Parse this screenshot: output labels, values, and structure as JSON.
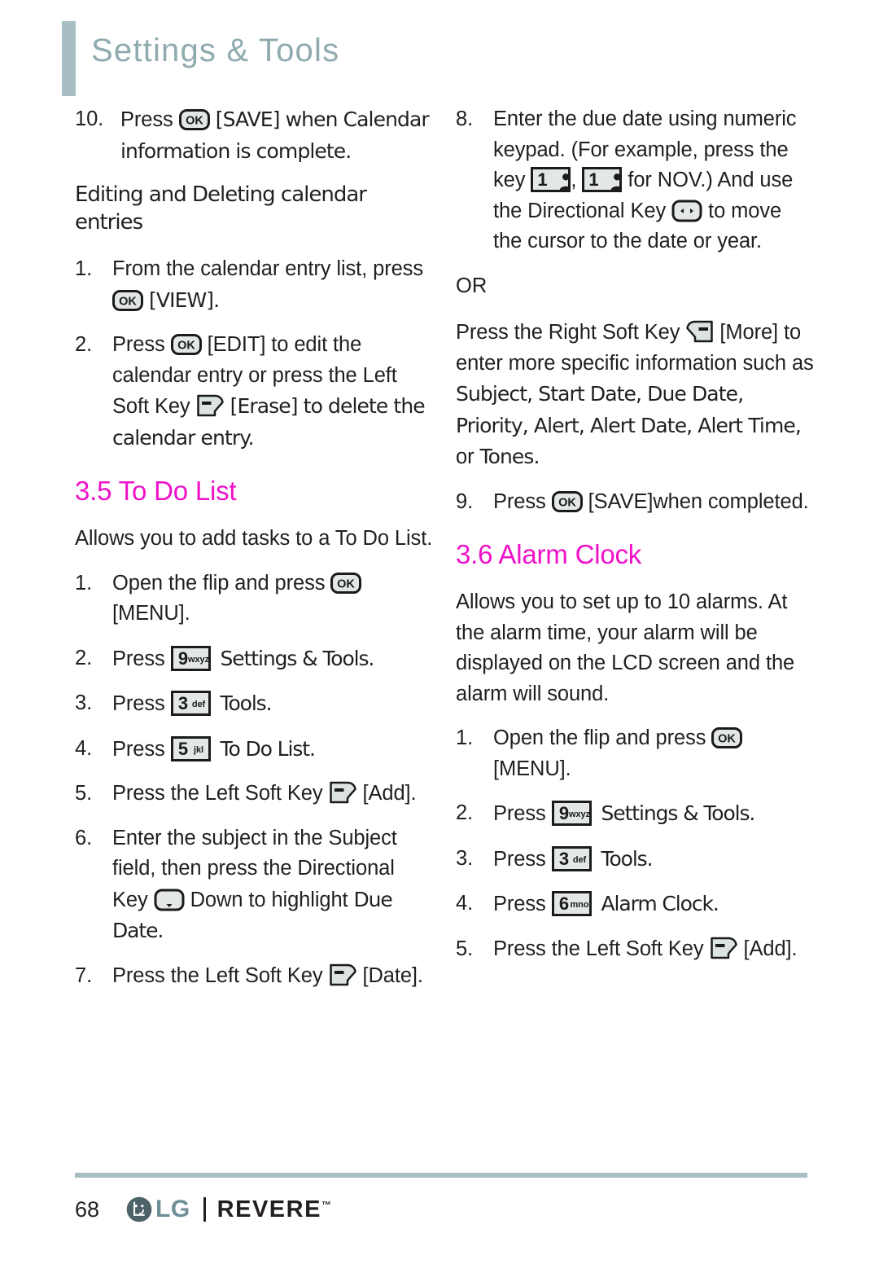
{
  "header": {
    "title": "Settings & Tools",
    "accent_color": "#a7bfc4"
  },
  "section_color": "#f011c9",
  "icons": {
    "ok_label": "OK",
    "key_9": {
      "digit": "9",
      "letters": "wxyz"
    },
    "key_3": {
      "digit": "3",
      "letters": "def"
    },
    "key_5": {
      "digit": "5",
      "letters": "jkl"
    },
    "key_6": {
      "digit": "6",
      "letters": "mno"
    },
    "key_1": {
      "digit": "1",
      "letters": ""
    }
  },
  "left_column": {
    "step10": {
      "num": "10.",
      "t1": "Press ",
      "t2": " [SAVE] when Calendar information is complete."
    },
    "subheading": "Editing and Deleting calendar entries",
    "step1": {
      "num": "1.",
      "t1": "From the calendar entry list, press ",
      "t2": " [VIEW]."
    },
    "step2": {
      "num": "2.",
      "t1": "Press ",
      "t2": " [EDIT] to edit the calendar entry or press the Left Soft Key ",
      "t3": " [Erase] to delete the calendar entry."
    },
    "section_heading": "3.5 To Do List",
    "intro": "Allows you to add tasks to a To Do List.",
    "todo1": {
      "num": "1.",
      "t1": "Open the flip and press ",
      "t2": " [MENU]."
    },
    "todo2": {
      "num": "2.",
      "t1": "Press ",
      "t2": " Settings & Tools."
    },
    "todo3": {
      "num": "3.",
      "t1": "Press ",
      "t2": " Tools."
    },
    "todo4": {
      "num": "4.",
      "t1": "Press ",
      "t2": " To Do List."
    },
    "todo5": {
      "num": "5.",
      "t1": "Press the Left Soft Key ",
      "t2": " [Add]."
    },
    "todo6": {
      "num": "6.",
      "t1": "Enter the subject in the Subject field, then press the Directional Key ",
      "t2": " Down to highlight ",
      "t3": "Due Date."
    },
    "todo7": {
      "num": "7.",
      "t1": "Press the Left Soft Key ",
      "t2": " [Date]."
    }
  },
  "right_column": {
    "step8": {
      "num": "8.",
      "t1": "Enter the due date using numeric keypad. (For example, press the key ",
      "t2": ", ",
      "t3": " for NOV.) And use the Directional Key ",
      "t4": " to move the cursor to the date or year."
    },
    "or": "OR",
    "more": {
      "t1": "Press the Right Soft Key ",
      "t2": " [More] to enter more specific information such as ",
      "t3": "Subject, Start Date, Due Date, Priority, Alert, Alert Date, Alert Time,",
      "t4": " or ",
      "t5": "Tones."
    },
    "step9": {
      "num": "9.",
      "t1": "Press ",
      "t2": " [SAVE]when completed."
    },
    "section_heading": "3.6 Alarm Clock",
    "intro": "Allows you to set up to 10 alarms. At the alarm time, your alarm will be displayed on the LCD screen and the alarm will sound.",
    "alarm1": {
      "num": "1.",
      "t1": "Open the flip and press ",
      "t2": " [MENU]."
    },
    "alarm2": {
      "num": "2.",
      "t1": "Press ",
      "t2": " Settings & Tools."
    },
    "alarm3": {
      "num": "3.",
      "t1": "Press ",
      "t2": " Tools."
    },
    "alarm4": {
      "num": "4.",
      "t1": "Press ",
      "t2": " Alarm Clock."
    },
    "alarm5": {
      "num": "5.",
      "t1": "Press the Left Soft Key ",
      "t2": " [Add]."
    }
  },
  "footer": {
    "page_number": "68",
    "brand": "LG",
    "model": "REVERE",
    "trademark": "™"
  }
}
